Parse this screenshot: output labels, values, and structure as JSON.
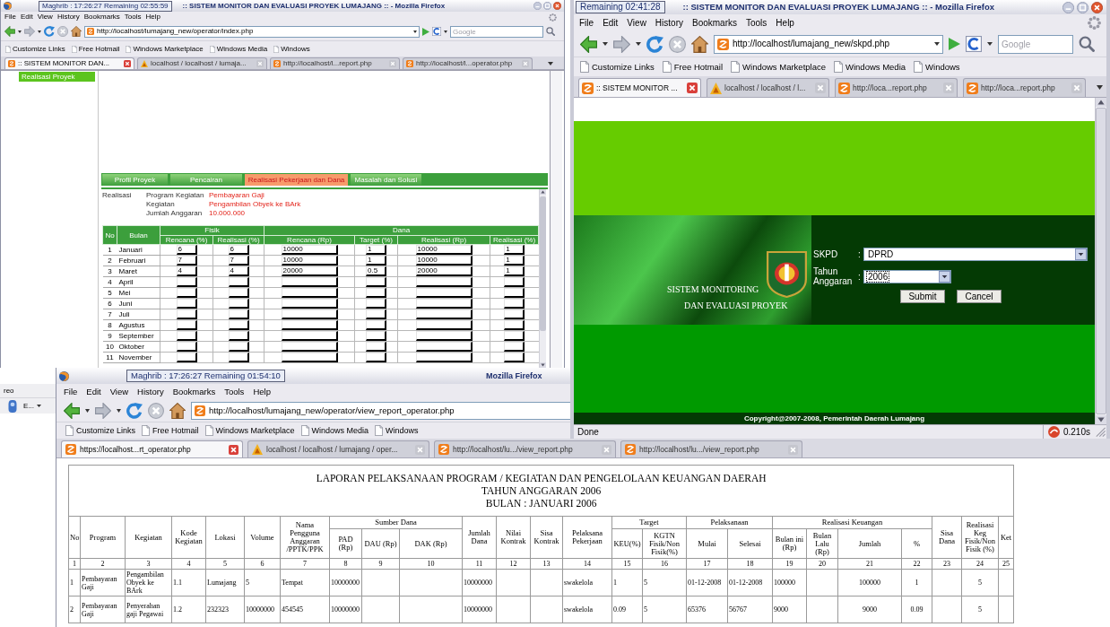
{
  "desktop": {
    "side_window": {
      "label": "reo",
      "button": "E..."
    }
  },
  "back_window": {
    "title_clock": "Maghrib : 17:26:27 Remaining 02:55:59",
    "title": ":: SISTEM MONITOR DAN EVALUASI PROYEK LUMAJANG :: - Mozilla Firefox",
    "menu": [
      "File",
      "Edit",
      "View",
      "History",
      "Bookmarks",
      "Tools",
      "Help"
    ],
    "address": "http://localhost/lumajang_new/operator/index.php",
    "search": {
      "placeholder": "Google"
    },
    "bookmarks": [
      "Customize Links",
      "Free Hotmail",
      "Windows Marketplace",
      "Windows Media",
      "Windows"
    ],
    "tabs": [
      {
        "label": ":: SISTEM MONITOR DAN...",
        "kind": "app",
        "selected": true
      },
      {
        "label": "localhost / localhost / lumaja...",
        "kind": "db",
        "selected": false
      },
      {
        "label": "http://localhost/l...report.php",
        "kind": "app",
        "selected": false
      },
      {
        "label": "http://localhost/l...operator.php",
        "kind": "app",
        "selected": false
      }
    ],
    "sidebar": {
      "items": [
        {
          "label": "Realisasi Proyek"
        }
      ]
    },
    "page_tabs": [
      {
        "label": "Profil Proyek",
        "selected": false
      },
      {
        "label": "Pencairan",
        "selected": false
      },
      {
        "label": "Realisasi Pekerjaan dan Dana",
        "selected": true
      },
      {
        "label": "Masalah dan Solusi",
        "selected": false
      }
    ],
    "info": {
      "heading": "Realisasi",
      "fields": [
        {
          "label": "Program Kegiatan",
          "value": "Pembayaran Gaji"
        },
        {
          "label": "Kegiatan",
          "value": "Pengambilan Obyek ke BArk"
        },
        {
          "label": "Jumlah Anggaran",
          "value": "10.000.000"
        }
      ]
    },
    "progress_table": {
      "columns": [
        {
          "label": "No"
        },
        {
          "label": "Bulan"
        },
        {
          "label": "Fisik",
          "children": [
            "Rencana (%)",
            "Realisasi (%)"
          ]
        },
        {
          "label": "Dana",
          "children": [
            "Rencana (Rp)",
            "Target (%)",
            "Realisasi (Rp)",
            "Realisasi (%)"
          ]
        }
      ],
      "rows": [
        {
          "no": "1",
          "month": "Januari",
          "values": [
            "6",
            "6",
            "10000",
            "1",
            "10000",
            "1"
          ]
        },
        {
          "no": "2",
          "month": "Februari",
          "values": [
            "7",
            "7",
            "10000",
            "1",
            "10000",
            "1"
          ]
        },
        {
          "no": "3",
          "month": "Maret",
          "values": [
            "4",
            "4",
            "20000",
            "0.5",
            "20000",
            "1"
          ]
        },
        {
          "no": "4",
          "month": "April"
        },
        {
          "no": "5",
          "month": "Mei"
        },
        {
          "no": "6",
          "month": "Juni"
        },
        {
          "no": "7",
          "month": "Juli"
        },
        {
          "no": "8",
          "month": "Agustus"
        },
        {
          "no": "9",
          "month": "September"
        },
        {
          "no": "10",
          "month": "Oktober"
        },
        {
          "no": "11",
          "month": "November"
        }
      ]
    }
  },
  "report_window": {
    "title_clock": "Maghrib : 17:26:27 Remaining 01:54:10",
    "title": "Mozilla Firefox",
    "menu": [
      "File",
      "Edit",
      "View",
      "History",
      "Bookmarks",
      "Tools",
      "Help"
    ],
    "address": "http://localhost/lumajang_new/operator/view_report_operator.php",
    "bookmarks": [
      "Customize Links",
      "Free Hotmail",
      "Windows Marketplace",
      "Windows Media",
      "Windows"
    ],
    "tabs": [
      {
        "label": "https://localhost...rt_operator.php",
        "kind": "app",
        "selected": true
      },
      {
        "label": "localhost / localhost / lumajang / oper...",
        "kind": "db",
        "selected": false
      },
      {
        "label": "http://localhost/lu.../view_report.php",
        "kind": "app",
        "selected": false
      },
      {
        "label": "http://localhost/lu.../view_report.php",
        "kind": "app",
        "selected": false
      }
    ],
    "report": {
      "title_lines": [
        "LAPORAN PELAKSANAAN PROGRAM / KEGIATAN DAN PENGELOLAAN KEUANGAN DAERAH",
        "TAHUN ANGGARAN 2006",
        "BULAN : JANUARI 2006"
      ],
      "header": [
        {
          "label": "No"
        },
        {
          "label": "Program"
        },
        {
          "label": "Kegiatan"
        },
        {
          "label": "Kode Kegiatan"
        },
        {
          "label": "Lokasi"
        },
        {
          "label": "Volume"
        },
        {
          "label": "Nama Pengguna Anggaran /PPTK/PPK"
        },
        {
          "label": "Sumber Dana",
          "children": [
            "PAD (Rp)",
            "DAU (Rp)",
            "DAK (Rp)"
          ]
        },
        {
          "label": "Jumlah Dana"
        },
        {
          "label": "Nilai Kontrak"
        },
        {
          "label": "Sisa Kontrak"
        },
        {
          "label": "Pelaksana Pekerjaan"
        },
        {
          "label": "Target",
          "children": [
            "KEU(%)",
            "KGTN Fisik/Non Fisik(%)"
          ]
        },
        {
          "label": "Pelaksanaan",
          "children": [
            "Mulai",
            "Selesai"
          ]
        },
        {
          "label": "Realisasi Keuangan",
          "children": [
            "Bulan ini (Rp)",
            "Bulan Lalu (Rp)",
            "Jumlah",
            "%"
          ]
        },
        {
          "label": "Sisa Dana"
        },
        {
          "label": "Realisasi Keg Fisik/Non Fisik (%)"
        },
        {
          "label": "Ket"
        }
      ],
      "column_numbers": [
        "1",
        "2",
        "3",
        "4",
        "5",
        "6",
        "7",
        "8",
        "9",
        "10",
        "11",
        "12",
        "13",
        "14",
        "15",
        "16",
        "17",
        "18",
        "19",
        "20",
        "21",
        "22",
        "23",
        "24",
        "25"
      ],
      "rows": [
        {
          "no": "1",
          "program": "Pembayaran Gaji",
          "kegiatan": "Pengambilan Obyek ke BArk",
          "kode_kegiatan": "1.1",
          "lokasi": "Lumajang",
          "volume": "5",
          "nama_pengguna_anggaran": "Tempat",
          "pad": "10000000",
          "jumlah_dana": "10000000",
          "pelaksana": "swakelola",
          "target_keu": "1",
          "target_fisik": "5",
          "mulai": "01-12-2008",
          "selesai": "01-12-2008",
          "bulan_ini": "100000",
          "jumlah": "100000",
          "persen": "1",
          "realisasi_fisik": "5"
        },
        {
          "no": "2",
          "program": "Pembayaran Gaji",
          "kegiatan": "Penyerahan gaji Pegawai",
          "kode_kegiatan": "1.2",
          "lokasi": "232323",
          "volume": "10000000",
          "nama_pengguna_anggaran": "454545",
          "pad": "10000000",
          "jumlah_dana": "10000000",
          "pelaksana": "swakelola",
          "target_keu": "0.09",
          "target_fisik": "5",
          "mulai": "65376",
          "selesai": "56767",
          "bulan_ini": "9000",
          "jumlah": "9000",
          "persen": "0.09",
          "realisasi_fisik": "5"
        }
      ]
    }
  },
  "front_window": {
    "title_clock": "Remaining 02:41:28",
    "title": ":: SISTEM MONITOR DAN EVALUASI PROYEK LUMAJANG :: - Mozilla Firefox",
    "menu": [
      "File",
      "Edit",
      "View",
      "History",
      "Bookmarks",
      "Tools",
      "Help"
    ],
    "address": "http://localhost/lumajang_new/skpd.php",
    "search": {
      "placeholder": "Google"
    },
    "bookmarks": [
      "Customize Links",
      "Free Hotmail",
      "Windows Marketplace",
      "Windows Media",
      "Windows"
    ],
    "tabs": [
      {
        "label": ":: SISTEM MONITOR ...",
        "kind": "app",
        "selected": true
      },
      {
        "label": "localhost / localhost / l...",
        "kind": "db",
        "selected": false
      },
      {
        "label": "http://loca...report.php",
        "kind": "app",
        "selected": false
      },
      {
        "label": "http://loca...report.php",
        "kind": "app",
        "selected": false
      }
    ],
    "banner": {
      "caption": [
        "SISTEM MONITORING",
        "DAN EVALUASI PROYEK"
      ]
    },
    "form": {
      "fields": [
        {
          "label": "SKPD",
          "separator": ":",
          "value": "DPRD",
          "focused": false
        },
        {
          "label": "Tahun Anggaran",
          "separator": ":",
          "value": "2006",
          "focused": true
        }
      ],
      "buttons": [
        "Submit",
        "Cancel"
      ]
    },
    "footer": "Copyright@2007-2008, Pemerintah Daerah Lumajang",
    "status": {
      "text": "Done",
      "timing": "0.210s"
    }
  }
}
